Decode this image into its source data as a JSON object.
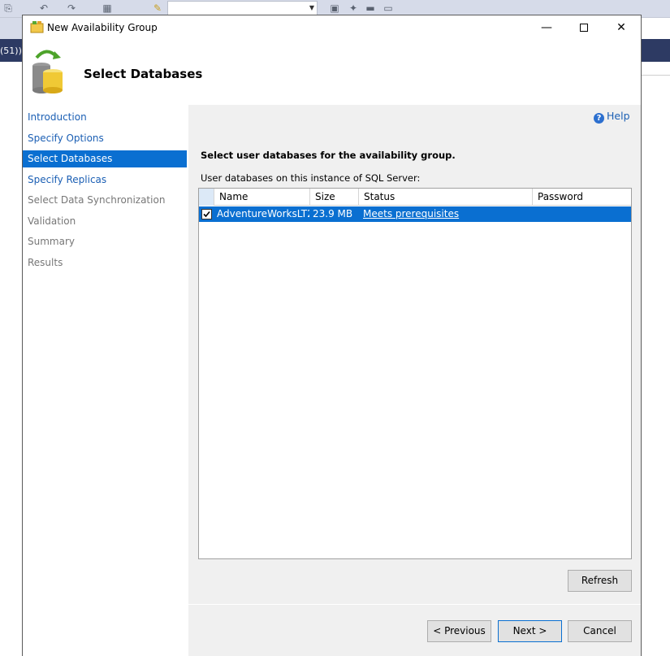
{
  "background_app": {
    "tab_text": "(51))"
  },
  "dialog": {
    "title": "New Availability Group",
    "header_title": "Select Databases",
    "window_controls": {
      "minimize": "—",
      "close": "✕"
    }
  },
  "nav": {
    "items": [
      {
        "label": "Introduction",
        "state": "link"
      },
      {
        "label": "Specify Options",
        "state": "link"
      },
      {
        "label": "Select Databases",
        "state": "active"
      },
      {
        "label": "Specify Replicas",
        "state": "link"
      },
      {
        "label": "Select Data Synchronization",
        "state": "dim"
      },
      {
        "label": "Validation",
        "state": "dim"
      },
      {
        "label": "Summary",
        "state": "dim"
      },
      {
        "label": "Results",
        "state": "dim"
      }
    ]
  },
  "content": {
    "help_label": "Help",
    "instruction": "Select user databases for the availability group.",
    "grid_label": "User databases on this instance of SQL Server:",
    "columns": [
      "Name",
      "Size",
      "Status",
      "Password"
    ],
    "rows": [
      {
        "checked": true,
        "name": "AdventureWorksLT2...",
        "size": "23.9 MB",
        "status": "Meets prerequisites",
        "password": ""
      }
    ],
    "refresh_label": "Refresh"
  },
  "footer": {
    "previous_label": "< Previous",
    "next_label": "Next >",
    "cancel_label": "Cancel"
  },
  "colors": {
    "accent": "#0a6fd1",
    "link": "#1b5fb4",
    "dim": "#777777",
    "panel": "#f0f0f0"
  }
}
